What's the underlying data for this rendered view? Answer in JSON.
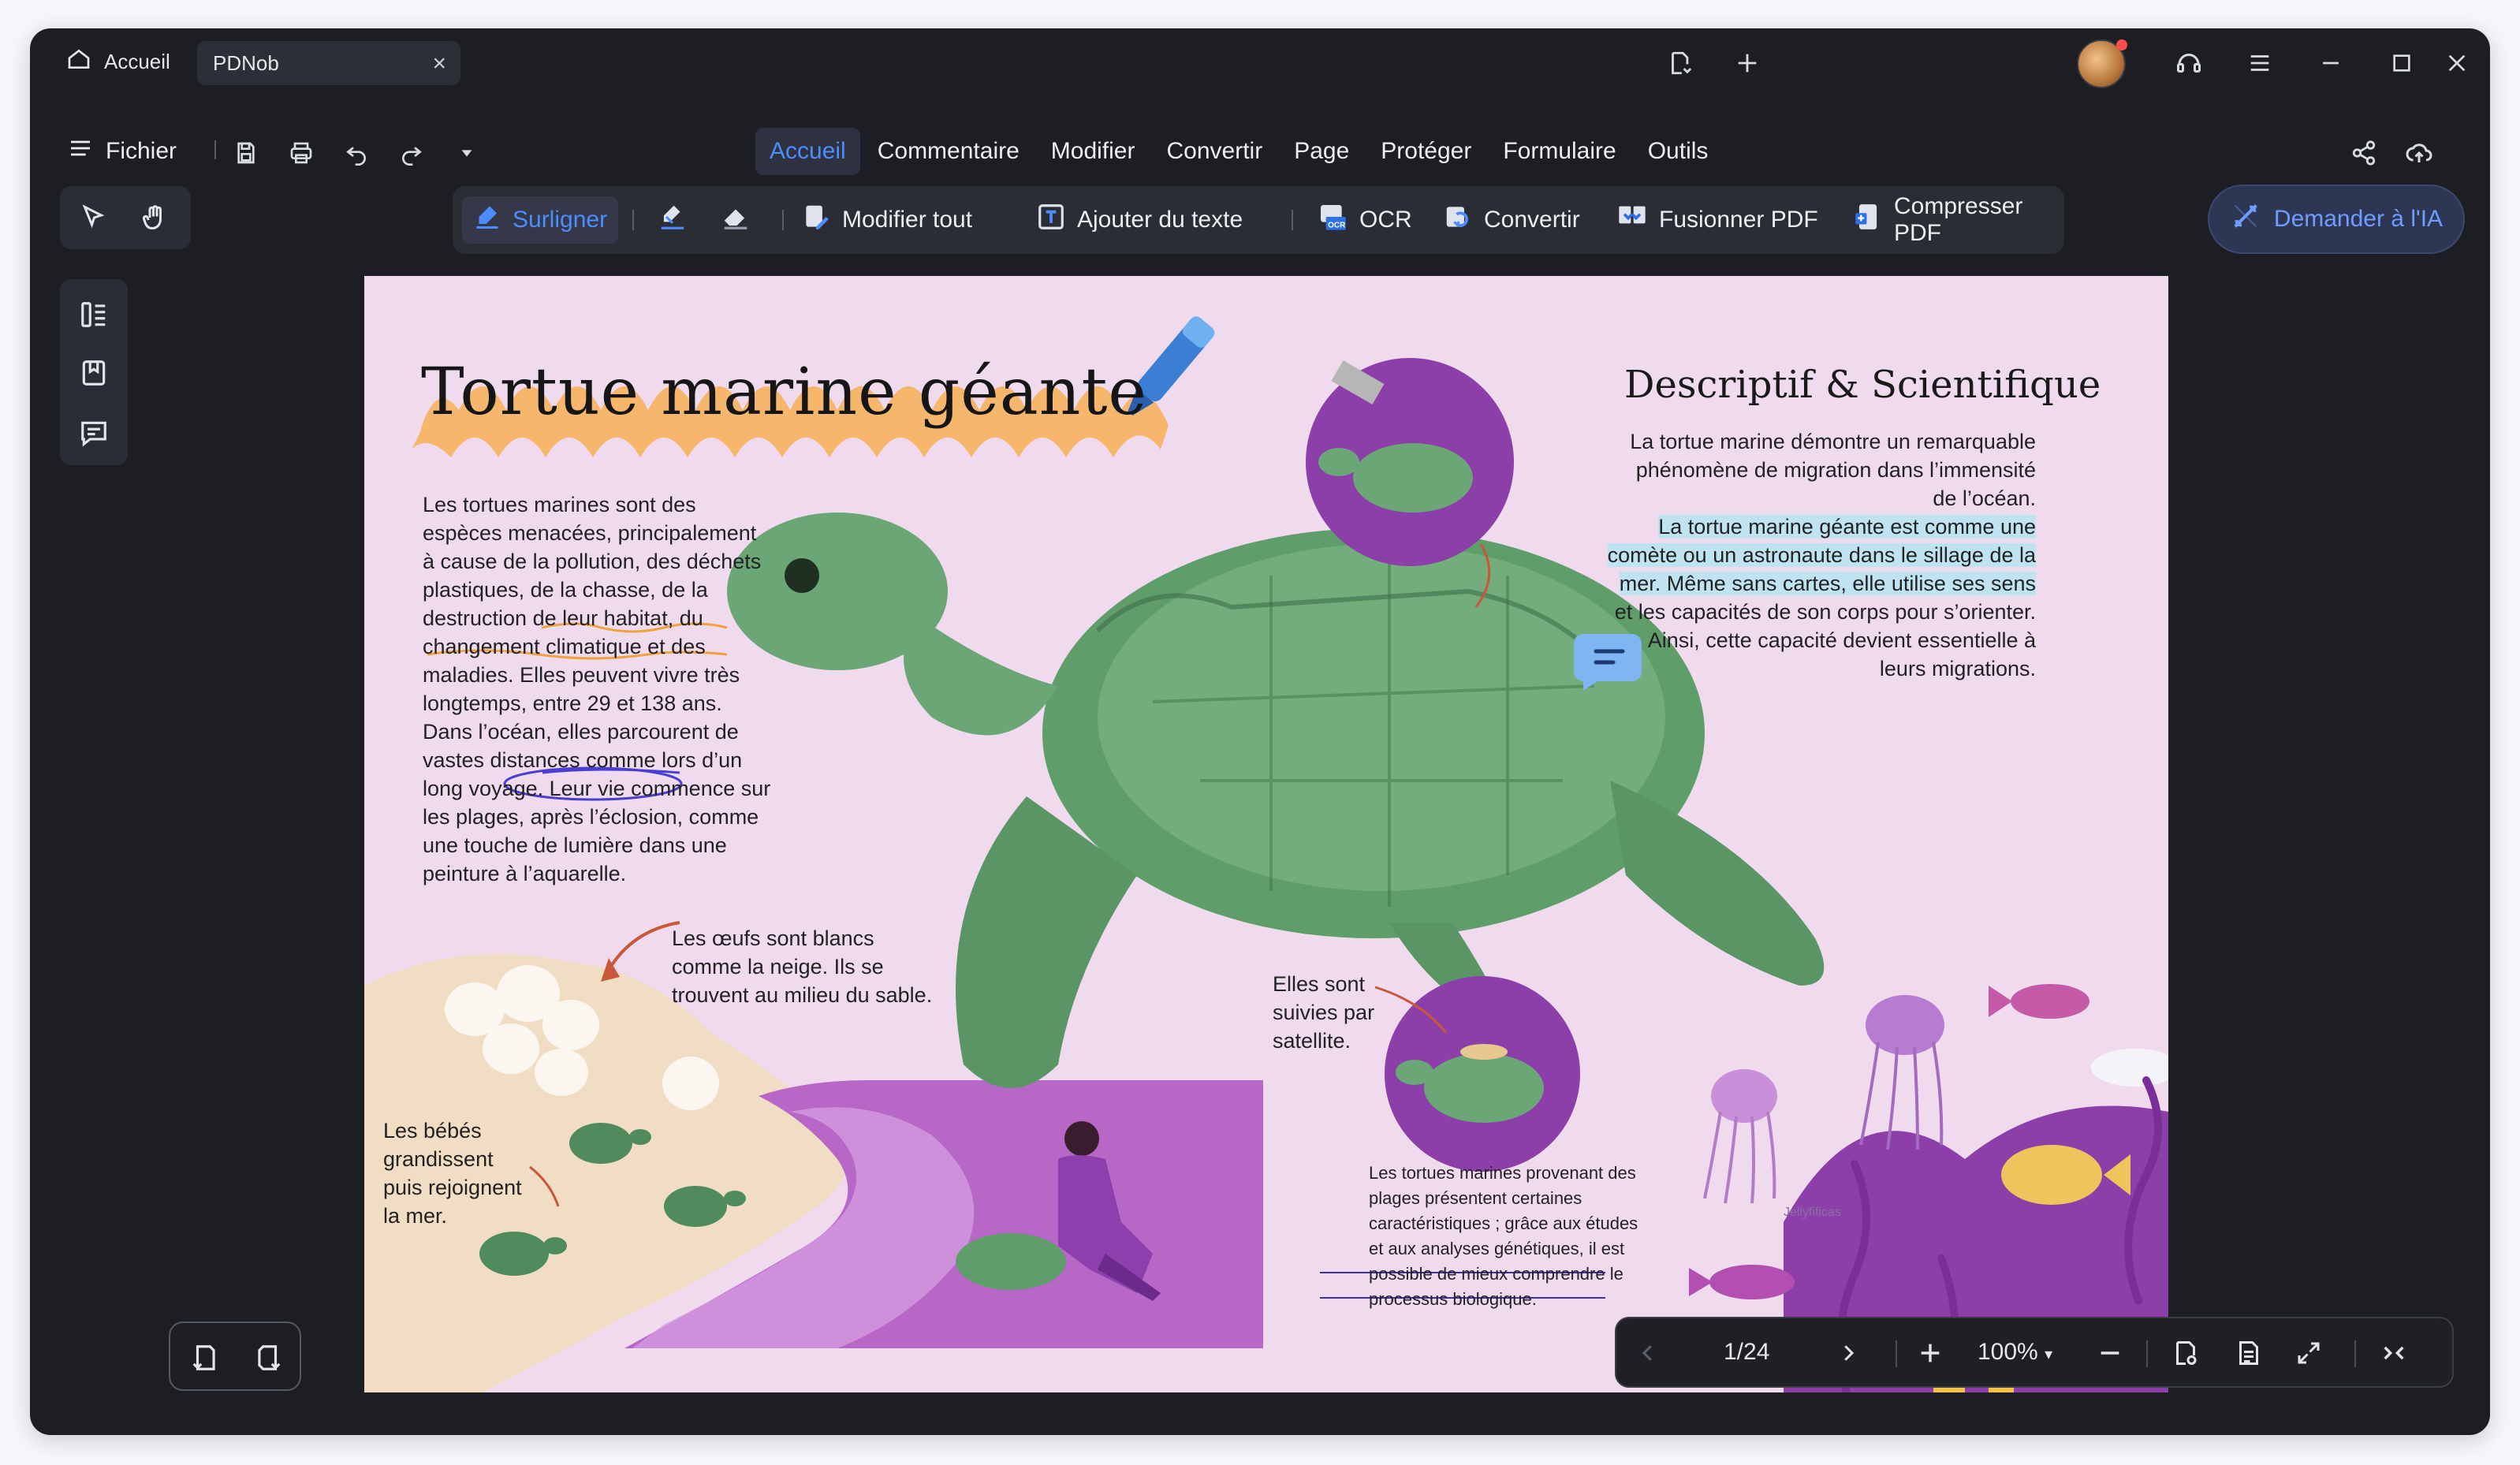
{
  "titlebar": {
    "home_tab": "Accueil",
    "doc_tab": "PDNob",
    "close_symbol": "×"
  },
  "menubar": {
    "file_label": "Fichier",
    "tabs": [
      "Accueil",
      "Commentaire",
      "Modifier",
      "Convertir",
      "Page",
      "Protéger",
      "Formulaire",
      "Outils"
    ],
    "active_tab": "Accueil"
  },
  "toolbar": {
    "highlight": "Surligner",
    "edit_all": "Modifier tout",
    "add_text": "Ajouter du texte",
    "ocr": "OCR",
    "convert": "Convertir",
    "merge": "Fusionner PDF",
    "compress": "Compresser PDF",
    "ask_ai": "Demander à l'IA"
  },
  "document": {
    "title": "Tortue marine géante",
    "intro": [
      "Les tortues marines sont des",
      "espèces menacées, principalement",
      "à cause de la pollution, des déchets",
      "plastiques, de la chasse, de la",
      "destruction de leur habitat, du",
      "changement climatique et des",
      "maladies. Elles peuvent vivre très",
      "longtemps, entre 29 et 138 ans.",
      "Dans l’océan, elles parcourent de",
      "vastes distances comme lors d’un",
      "long voyage. Leur vie commence sur",
      "les plages, après l’éclosion, comme",
      "une touche de lumière dans une",
      "peinture à l’aquarelle."
    ],
    "eggs_caption": [
      "Les œufs sont blancs",
      "comme la neige. Ils se",
      "trouvent au milieu du sable."
    ],
    "babies_caption": [
      "Les bébés",
      "grandissent",
      "puis rejoignent",
      "la mer."
    ],
    "satellite_caption": [
      "Elles sont",
      "suivies par",
      "satellite."
    ],
    "science_title": "Descriptif & Scientifique",
    "science_lines": [
      "La tortue marine démontre un remarquable",
      "phénomène de migration dans l’immensité",
      "de l’océan."
    ],
    "science_highlight": [
      "La tortue marine géante est comme une",
      "comète ou un astronaute dans le sillage de la",
      "mer. Même sans cartes, elle utilise ses sens"
    ],
    "science_end": [
      "et les capacités de son corps pour s’orienter.",
      "Ainsi, cette capacité devient essentielle à",
      "leurs migrations."
    ],
    "genetic_text": [
      "Les tortues marines provenant des",
      "plages présentent certaines",
      "caractéristiques ; grâce aux études",
      "et aux analyses génétiques, il est",
      "possible de mieux comprendre le",
      "processus biologique."
    ],
    "jellyfish_label": "Jellyfificas"
  },
  "navigation": {
    "page_indicator": "1/24",
    "zoom": "100%",
    "zoom_caret": "▾"
  },
  "colors": {
    "accent": "#4d8cff",
    "page_bg": "#f0dbee",
    "title_highlight": "#f6b25d",
    "turtle": "#5f9d6b",
    "purple": "#8c3fa8",
    "text_highlight": "#bfe3f1"
  },
  "icons": [
    "home-icon",
    "close-icon",
    "sync-icon",
    "plus-icon",
    "support-icon",
    "menu-icon",
    "minimize-icon",
    "maximize-icon",
    "hamburger-icon",
    "save-icon",
    "print-icon",
    "undo-icon",
    "redo-icon",
    "caret-icon",
    "share-icon",
    "upload-icon",
    "cursor-icon",
    "hand-icon",
    "highlighter-icon",
    "underline-icon",
    "eraser-icon",
    "edit-icon",
    "text-icon",
    "ocr-icon",
    "convert-icon",
    "merge-icon",
    "compress-icon",
    "ai-icon",
    "thumbnails-icon",
    "bookmark-icon",
    "comment-icon",
    "rotate-left-icon",
    "rotate-right-icon",
    "prev-icon",
    "next-icon",
    "zoom-in-icon",
    "zoom-out-icon",
    "view-icon",
    "page-icon",
    "fullscreen-icon",
    "collapse-icon"
  ]
}
